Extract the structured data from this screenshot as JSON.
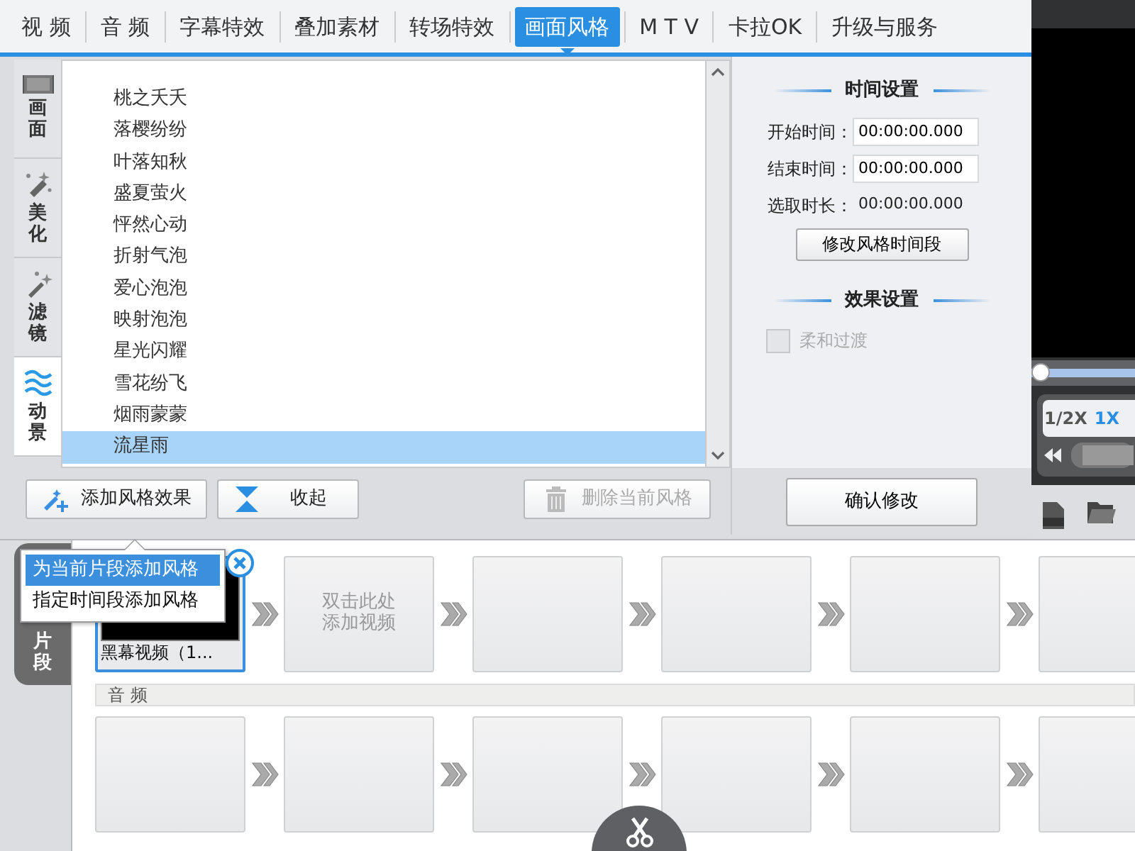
{
  "top_tabs": [
    {
      "label": "视 频",
      "selected": false
    },
    {
      "label": "音 频",
      "selected": false
    },
    {
      "label": "字幕特效",
      "selected": false
    },
    {
      "label": "叠加素材",
      "selected": false
    },
    {
      "label": "转场特效",
      "selected": false
    },
    {
      "label": "画面风格",
      "selected": true
    },
    {
      "label": "M T V",
      "selected": false
    },
    {
      "label": "卡拉OK",
      "selected": false
    },
    {
      "label": "升级与服务",
      "selected": false
    }
  ],
  "side_tabs": [
    {
      "kind": "film",
      "label": "画面",
      "selected": false
    },
    {
      "kind": "beautify",
      "label": "美化",
      "selected": false
    },
    {
      "kind": "filter",
      "label": "滤镜",
      "selected": false
    },
    {
      "kind": "wave",
      "label": "动景",
      "selected": true
    }
  ],
  "effects_list": [
    {
      "label": "桃之夭夭",
      "selected": false
    },
    {
      "label": "落樱纷纷",
      "selected": false
    },
    {
      "label": "叶落知秋",
      "selected": false
    },
    {
      "label": "盛夏萤火",
      "selected": false
    },
    {
      "label": "怦然心动",
      "selected": false
    },
    {
      "label": "折射气泡",
      "selected": false
    },
    {
      "label": "爱心泡泡",
      "selected": false
    },
    {
      "label": "映射泡泡",
      "selected": false
    },
    {
      "label": "星光闪耀",
      "selected": false
    },
    {
      "label": "雪花纷飞",
      "selected": false
    },
    {
      "label": "烟雨蒙蒙",
      "selected": false
    },
    {
      "label": "流星雨",
      "selected": true
    }
  ],
  "action_buttons": [
    {
      "kind": "add",
      "label": "添加风格效果",
      "disabled": false
    },
    {
      "kind": "collapse",
      "label": "收起",
      "disabled": false
    },
    {
      "kind": "delete",
      "label": "删除当前风格",
      "disabled": true
    }
  ],
  "popup_menu": [
    {
      "label": "为当前片段添加风格",
      "selected": true
    },
    {
      "label": "指定时间段添加风格",
      "selected": false
    }
  ],
  "time_settings": {
    "title": "时间设置",
    "start_label": "开始时间：",
    "start_value": "00:00:00.000",
    "end_label": "结束时间：",
    "end_value": "00:00:00.000",
    "duration_label": "选取时长：",
    "duration_value": "00:00:00.000",
    "button": "修改风格时间段"
  },
  "effect_settings": {
    "title": "效果设置",
    "option": {
      "label": "柔和过渡",
      "checked": false,
      "disabled": true
    }
  },
  "confirm_button": "确认修改",
  "preview": {
    "level": 0,
    "speeds": [
      {
        "label": "1/2X",
        "selected": false
      },
      {
        "label": "1X",
        "selected": true
      }
    ]
  },
  "timeline": {
    "tab": "片段",
    "video_clips": [
      {
        "kind": "video",
        "caption": "黑幕视频（1...",
        "selected": true
      },
      {
        "kind": "placeholder",
        "lines": [
          "双击此处",
          "添加视频"
        ]
      },
      {
        "kind": "empty"
      },
      {
        "kind": "empty"
      },
      {
        "kind": "empty"
      },
      {
        "kind": "empty"
      }
    ],
    "audio_label": "音 频",
    "audio_clips": [
      {
        "kind": "empty"
      },
      {
        "kind": "empty"
      },
      {
        "kind": "empty"
      },
      {
        "kind": "empty"
      },
      {
        "kind": "empty"
      },
      {
        "kind": "empty"
      }
    ]
  }
}
